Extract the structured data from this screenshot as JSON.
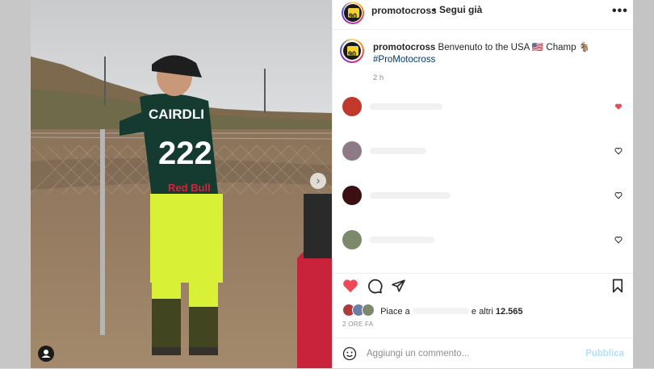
{
  "header": {
    "username": "promotocross",
    "separator": "•",
    "follow_label": "Segui già",
    "more_label": "•••",
    "logo_text": "90"
  },
  "caption": {
    "username": "promotocross",
    "text": "Benvenuto to the USA 🇺🇸 Champ 🐐",
    "hashtag": "#ProMotocross",
    "time": "2 h"
  },
  "rider": {
    "name": "CAIRDLI",
    "number": "222",
    "sponsor": "Red Bull"
  },
  "likes": {
    "prefix": "Piace a",
    "suffix": "e altri",
    "count": "12.565"
  },
  "post_time": "2 ORE FA",
  "comment_box": {
    "placeholder": "Aggiungi un commento...",
    "publish_label": "Pubblica"
  },
  "colors": {
    "like_red": "#ed4956",
    "link_blue": "#00376b",
    "publish_disabled": "#b2dffc"
  }
}
